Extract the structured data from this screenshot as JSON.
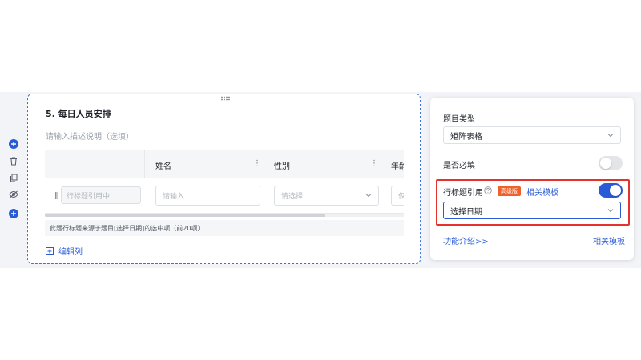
{
  "toolbar": {
    "icons": [
      "add-icon",
      "trash-icon",
      "copy-icon",
      "hide-icon",
      "add-icon"
    ]
  },
  "question": {
    "title": "5. 每日人员安排",
    "description_placeholder": "请输入描述说明（选填）",
    "columns": [
      {
        "label": "姓名",
        "cell_placeholder": "请输入",
        "type": "input"
      },
      {
        "label": "性别",
        "cell_placeholder": "请选择",
        "type": "select"
      },
      {
        "label": "年龄",
        "cell_placeholder": "仅",
        "type": "input"
      }
    ],
    "row_title_placeholder": "行标题引用中",
    "reference_note": "此题行标题来源于题目[选择日期]的选中项（前20项）",
    "edit_columns_label": "编辑列"
  },
  "panel": {
    "question_type_label": "题目类型",
    "question_type_value": "矩阵表格",
    "required_label": "是否必填",
    "required_on": false,
    "row_title_ref_label": "行标题引用",
    "premium_badge": "高级版",
    "related_template_link": "相关模板",
    "row_title_ref_on": true,
    "ref_source_value": "选择日期",
    "feature_intro_link": "功能介绍>>",
    "related_template_link_bottom": "相关模板"
  },
  "colors": {
    "accent": "#2a5bd7",
    "highlight": "#e5322d",
    "badge": "#f0602b"
  }
}
